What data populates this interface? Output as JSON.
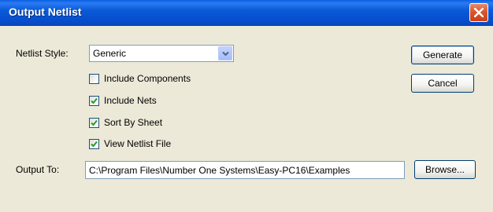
{
  "window": {
    "title": "Output Netlist",
    "close_icon": "close-icon"
  },
  "form": {
    "netlist_style_label": "Netlist Style:",
    "netlist_style_value": "Generic",
    "options": [
      {
        "label": "Include Components",
        "checked": false
      },
      {
        "label": "Include Nets",
        "checked": true
      },
      {
        "label": "Sort By Sheet",
        "checked": true
      },
      {
        "label": "View Netlist File",
        "checked": true
      }
    ],
    "output_to_label": "Output To:",
    "output_to_value": "C:\\Program Files\\Number One Systems\\Easy-PC16\\Examples"
  },
  "buttons": {
    "generate": "Generate",
    "cancel": "Cancel",
    "browse": "Browse..."
  },
  "colors": {
    "titlebar": "#0a5fe0",
    "dialog_bg": "#ece9d8",
    "close_button": "#d9572d",
    "checkmark": "#21a121"
  }
}
